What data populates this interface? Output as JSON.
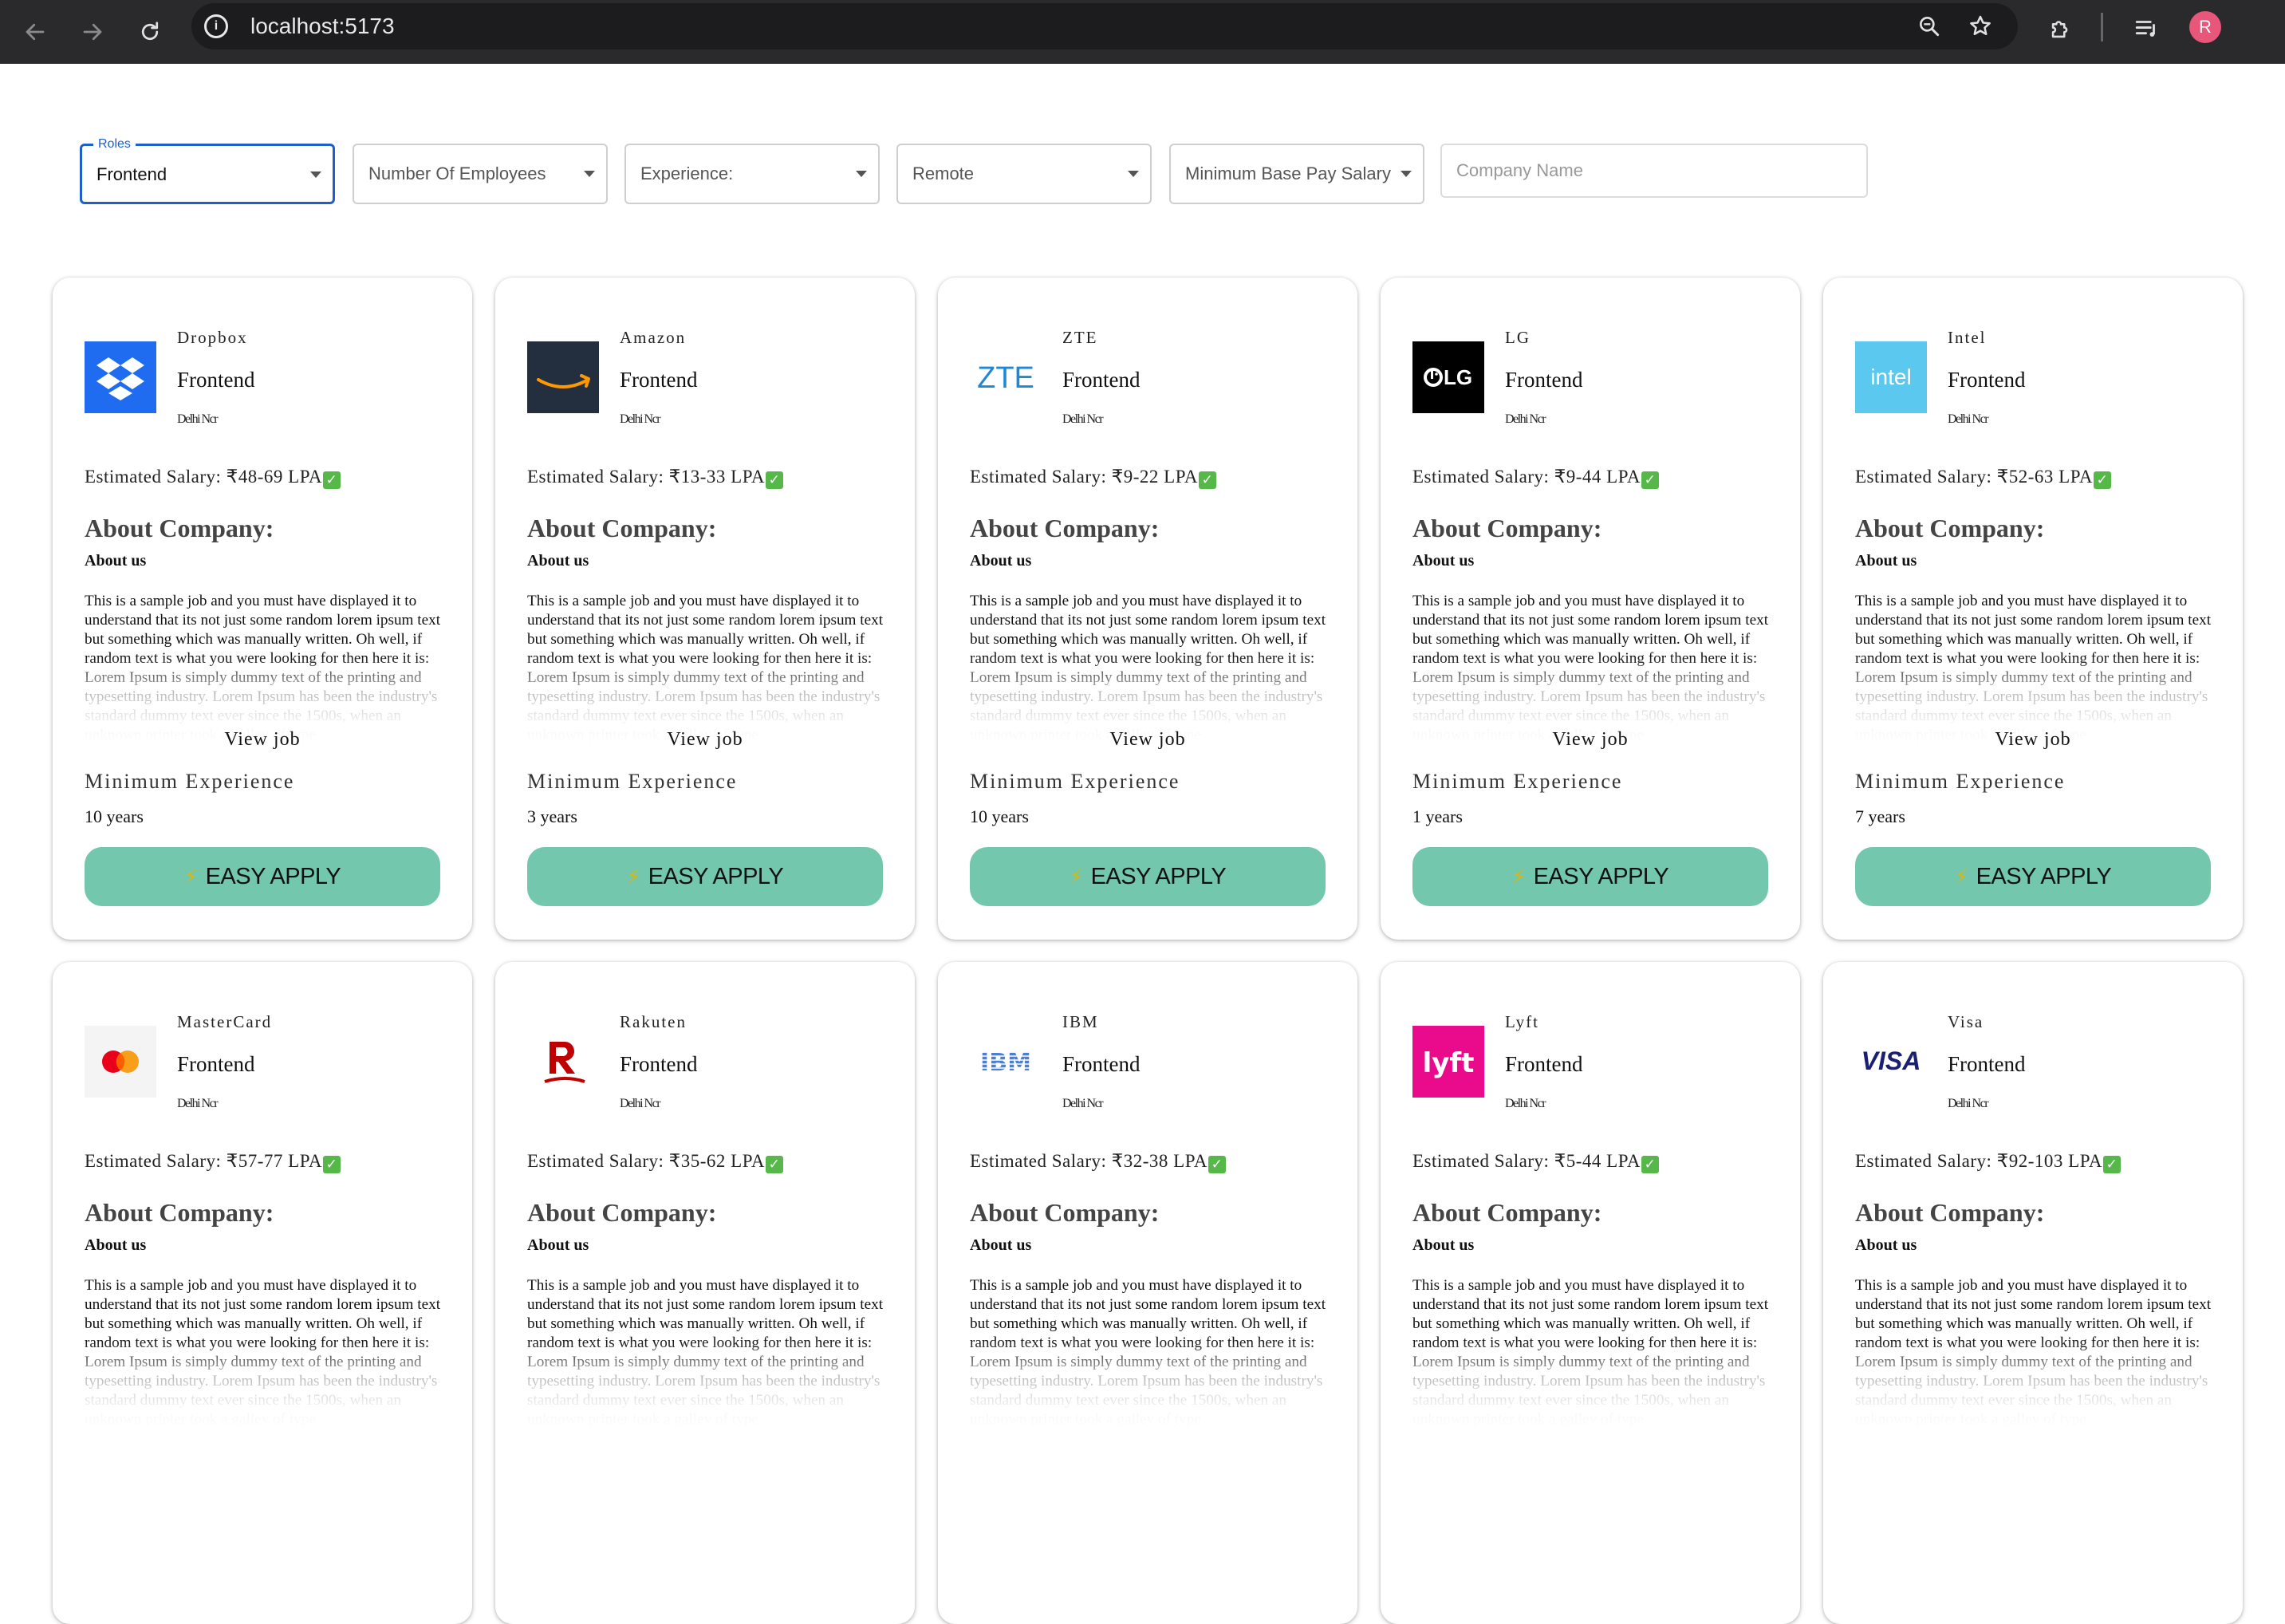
{
  "browser": {
    "url": "localhost:5173",
    "avatar_initial": "R"
  },
  "filters": {
    "roles": {
      "label": "Roles",
      "value": "Frontend"
    },
    "employees": {
      "placeholder": "Number Of Employees"
    },
    "experience": {
      "placeholder": "Experience:"
    },
    "remote": {
      "placeholder": "Remote"
    },
    "min_salary": {
      "placeholder": "Minimum Base Pay Salary"
    },
    "company": {
      "placeholder": "Company Name"
    }
  },
  "card_common": {
    "salary_prefix": "Estimated Salary: ",
    "salary_check": "✓",
    "about_title": "About Company:",
    "about_subtitle": "About us",
    "description": "This is a sample job and you must have displayed it to understand that its not just some random lorem ipsum text but something which was manually written. Oh well, if random text is what you were looking for then here it is: Lorem Ipsum is simply dummy text of the printing and typesetting industry. Lorem Ipsum has been the industry's standard dummy text ever since the 1500s, when an unknown printer took a galley of type",
    "view_job": "View job",
    "min_exp_label": "Minimum Experience",
    "apply_label": "EASY APPLY",
    "apply_icon": "lightning-bolt-icon"
  },
  "jobs": [
    {
      "company": "Dropbox",
      "role": "Frontend",
      "location": "Delhi Ncr",
      "salary": "₹48-69 LPA",
      "experience": "10 years",
      "logo": "dropbox-logo-icon"
    },
    {
      "company": "Amazon",
      "role": "Frontend",
      "location": "Delhi Ncr",
      "salary": "₹13-33 LPA",
      "experience": "3 years",
      "logo": "amazon-logo-icon"
    },
    {
      "company": "ZTE",
      "role": "Frontend",
      "location": "Delhi Ncr",
      "salary": "₹9-22 LPA",
      "experience": "10 years",
      "logo": "zte-logo-icon"
    },
    {
      "company": "LG",
      "role": "Frontend",
      "location": "Delhi Ncr",
      "salary": "₹9-44 LPA",
      "experience": "1 years",
      "logo": "lg-logo-icon"
    },
    {
      "company": "Intel",
      "role": "Frontend",
      "location": "Delhi Ncr",
      "salary": "₹52-63 LPA",
      "experience": "7 years",
      "logo": "intel-logo-icon"
    },
    {
      "company": "MasterCard",
      "role": "Frontend",
      "location": "Delhi Ncr",
      "salary": "₹57-77 LPA",
      "experience": "",
      "logo": "mastercard-logo-icon"
    },
    {
      "company": "Rakuten",
      "role": "Frontend",
      "location": "Delhi Ncr",
      "salary": "₹35-62 LPA",
      "experience": "",
      "logo": "rakuten-logo-icon"
    },
    {
      "company": "IBM",
      "role": "Frontend",
      "location": "Delhi Ncr",
      "salary": "₹32-38 LPA",
      "experience": "",
      "logo": "ibm-logo-icon"
    },
    {
      "company": "Lyft",
      "role": "Frontend",
      "location": "Delhi Ncr",
      "salary": "₹5-44 LPA",
      "experience": "",
      "logo": "lyft-logo-icon"
    },
    {
      "company": "Visa",
      "role": "Frontend",
      "location": "Delhi Ncr",
      "salary": "₹92-103 LPA",
      "experience": "",
      "logo": "visa-logo-icon"
    }
  ],
  "logo_text": {
    "zte": "ZTE",
    "lg": "LG",
    "intel": "intel",
    "ibm": "IBM",
    "lyft": "lyft",
    "visa": "VISA"
  },
  "colors": {
    "accent": "#1f5fc9",
    "apply_button": "#73c7ac",
    "check_badge": "#55b848",
    "bolt": "#e6b400"
  }
}
